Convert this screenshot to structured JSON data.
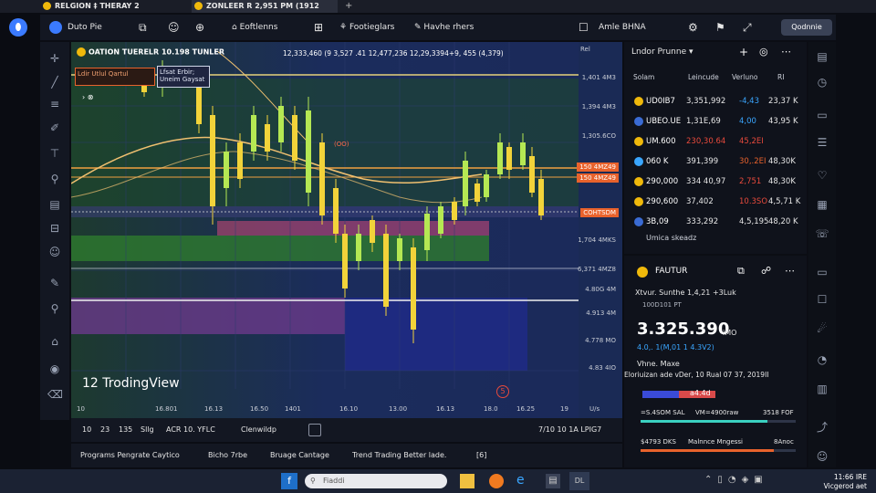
{
  "tabs": [
    {
      "label": "RELGION ‡ THERAY 2"
    },
    {
      "label": "ZONLEER R 2,951 PM (1912"
    }
  ],
  "toolbar": {
    "symbol": "Duto Pie",
    "items": [
      "Eoftlenns",
      "Footieglars",
      "Havhe rhers"
    ],
    "right_label": "Amle BHNA",
    "right_button": "Qodnnie"
  },
  "chart": {
    "header": "OATION TUERELR 10.198 TUNLER",
    "ohlc": "12,333,460  (9 3,527 .41  12,477,236  12,29,3394+9, 455 (4,379)",
    "indicator_label_1": "Ldir Utlul Qartul",
    "indicator_label_2": "Lfsat Erbir; Uneim Gaysat",
    "watermark": "12 TrodingView",
    "rel_label": "Rel",
    "ma_label": "(OO)",
    "marker": "5",
    "y_labels": [
      {
        "text": "1,401 4M3",
        "color": "#c9cdd6"
      },
      {
        "text": "1,394 4M3",
        "color": "#c9cdd6"
      },
      {
        "text": "1,305.6CO",
        "color": "#c9cdd6"
      },
      {
        "text": "150 4MZ49",
        "color": "#ffffff",
        "bg": "#e8622c"
      },
      {
        "text": "150 4MZ49",
        "color": "#ffffff",
        "bg": "#e8622c"
      },
      {
        "text": "COHTSDM",
        "color": "#ffffff",
        "bg": "#e8622c"
      },
      {
        "text": "1,704 4MKS",
        "color": "#c9cdd6"
      },
      {
        "text": "6,371 4MZ8",
        "color": "#c9cdd6"
      },
      {
        "text": "4.80G 4M",
        "color": "#c9cdd6"
      },
      {
        "text": "4.913 4M",
        "color": "#c9cdd6"
      },
      {
        "text": "4.778 MO",
        "color": "#c9cdd6"
      },
      {
        "text": "4.83 4IO",
        "color": "#c9cdd6"
      }
    ],
    "x_labels": [
      "10",
      "16.801",
      "16.13",
      "16.50",
      "1401",
      "16.10",
      "13.00",
      "16.13",
      "18.0",
      "16.25",
      "19"
    ],
    "x_unit": "U/s"
  },
  "bottom": {
    "intervals": [
      "10",
      "23",
      "135",
      "Sllg",
      "ACR 10. YFLC",
      "Clenwildp"
    ],
    "right_time": "7/10 10 1A LPIG7"
  },
  "bottom_tabs": [
    "Programs Pengrate Caytico",
    "Bicho 7rbe",
    "Bruage Cantage",
    "Trend Trading Better lade.",
    "[6]"
  ],
  "watchlist": {
    "title": "Lndor Prunne",
    "columns": [
      "Solam",
      "Leincude",
      "Verluno",
      "RI"
    ],
    "rows": [
      {
        "sym": "UD0IB7",
        "p": "3,351,992",
        "c": "-4,43",
        "v": "23,37 K",
        "pc": "#e6e6e6",
        "cc": "#3aa6ff",
        "icon": "#f0b90b"
      },
      {
        "sym": "UBEO.UE",
        "p": "1,31E,69",
        "c": "4,00",
        "v": "43,95 K",
        "pc": "#e6e6e6",
        "cc": "#3aa6ff",
        "icon": "#3a6bd4"
      },
      {
        "sym": "UM.600",
        "p": "230,30.64",
        "c": "45,2EI",
        "v": "",
        "pc": "#e84a3c",
        "cc": "#e84a3c",
        "icon": "#f0b90b"
      },
      {
        "sym": "060 K",
        "p": "391,399",
        "c": "30,.2EI",
        "v": "48,30K",
        "pc": "#e6e6e6",
        "cc": "#e8622c",
        "icon": "#3aa6ff"
      },
      {
        "sym": "290,000",
        "p": "334 40,97",
        "c": "2,751",
        "v": "48,30K",
        "pc": "#e6e6e6",
        "cc": "#e84a3c",
        "icon": "#f0b90b"
      },
      {
        "sym": "290,600",
        "p": "37,402",
        "c": "10.3SO",
        "v": "4,5,71 K",
        "pc": "#e6e6e6",
        "cc": "#e84a3c",
        "icon": "#f0b90b"
      },
      {
        "sym": "3B,09",
        "p": "333,292",
        "c": "4,5,195",
        "v": "48,20 K",
        "pc": "#e6e6e6",
        "cc": "#e6e6e6",
        "icon": "#3a6bd4"
      }
    ],
    "footer": "Umica skeadz"
  },
  "detail": {
    "title": "FAUTUR",
    "line1": "Xtvur. Sunthe 1,4,21  +3Luk",
    "line2": "100D101 PT",
    "price": "3.325.390",
    "price_unit": "iMO",
    "change": "4.0,. 1(M,01 1 4.3V2)",
    "line3": "Vhne. Maxe",
    "line4": "Eloriuizan ade vDer, 10 Rual 07 37, 2019II",
    "bar_label": "a4.4d",
    "bar2_left": "=S.4SOM SAL",
    "bar2_mid": "VM=4900raw",
    "bar2_right": "3518 FOF",
    "bar3_left": "$4793 DKS",
    "bar3_mid": "Malnnce Mngessi",
    "bar3_right": "8Anoc"
  },
  "taskbar": {
    "search_placeholder": "Fiaddi",
    "time": "11:66 IRE",
    "date": "Vicgerod aet"
  },
  "colors": {
    "up": "#b5e853",
    "down": "#f2d33a",
    "accent": "#e8622c"
  }
}
